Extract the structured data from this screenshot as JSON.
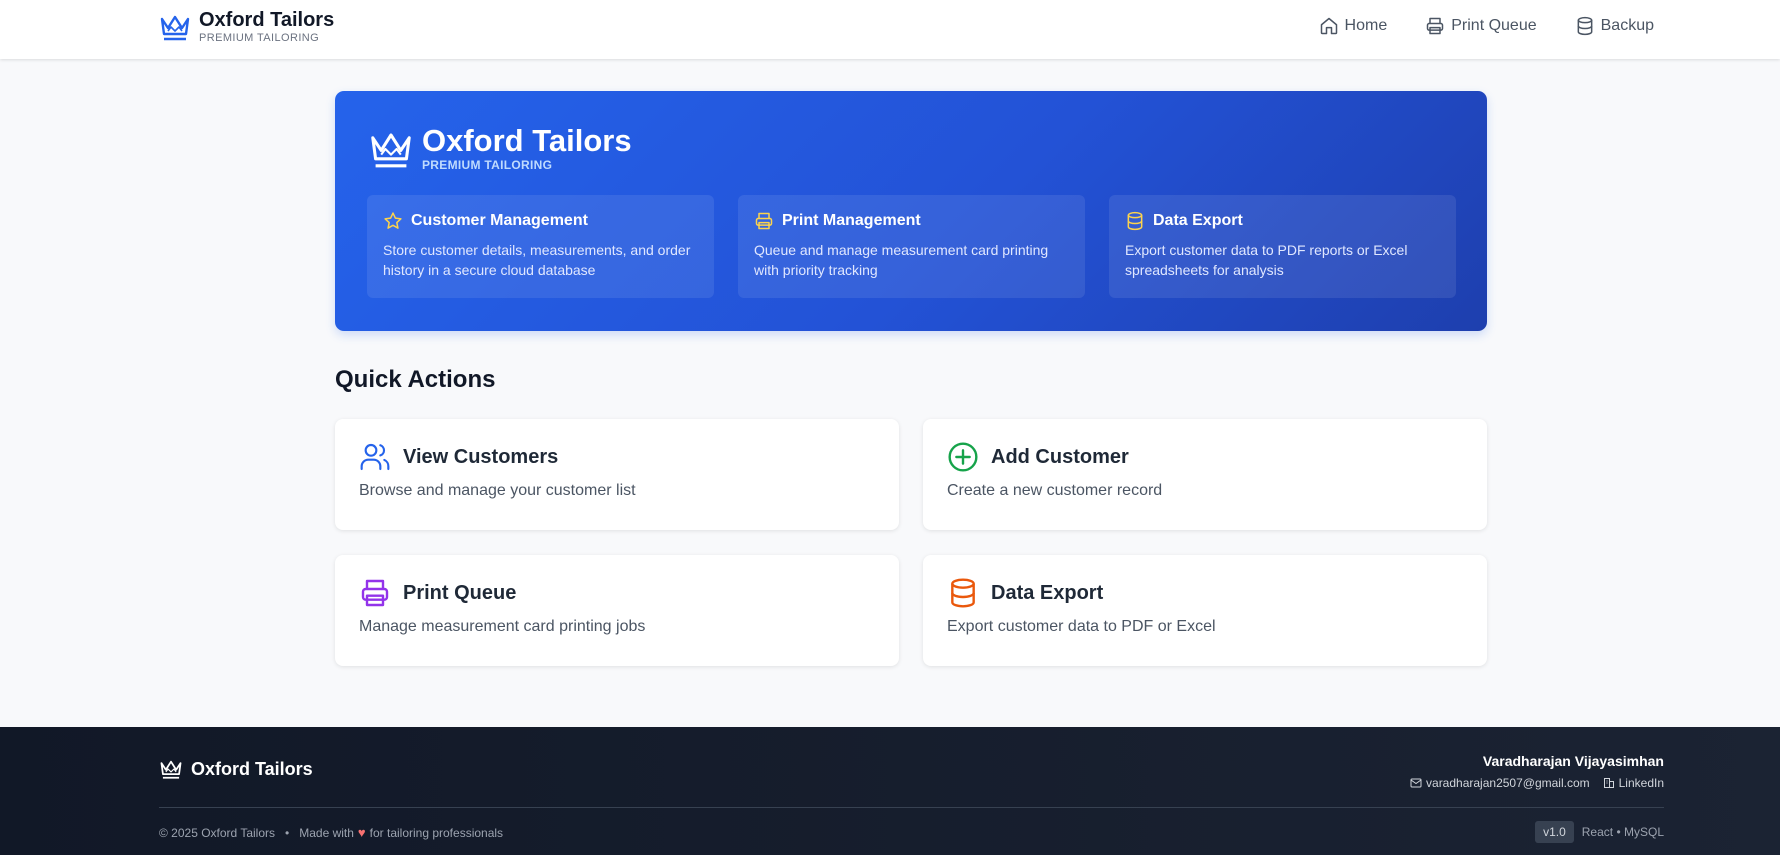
{
  "brand": {
    "name": "Oxford Tailors",
    "tagline": "PREMIUM TAILORING",
    "icon": "crown-icon",
    "accent": "#2563eb"
  },
  "nav": {
    "items": [
      {
        "label": "Home",
        "icon": "home-icon"
      },
      {
        "label": "Print Queue",
        "icon": "printer-icon"
      },
      {
        "label": "Backup",
        "icon": "database-icon"
      }
    ]
  },
  "hero": {
    "title": "Oxford Tailors",
    "subtitle": "PREMIUM TAILORING",
    "features": [
      {
        "title": "Customer Management",
        "description": "Store customer details, measurements, and order history in a secure cloud database",
        "icon": "star-icon"
      },
      {
        "title": "Print Management",
        "description": "Queue and manage measurement card printing with priority tracking",
        "icon": "printer-icon"
      },
      {
        "title": "Data Export",
        "description": "Export customer data to PDF reports or Excel spreadsheets for analysis",
        "icon": "database-icon"
      }
    ]
  },
  "quick_actions": {
    "heading": "Quick Actions",
    "cards": [
      {
        "title": "View Customers",
        "description": "Browse and manage your customer list",
        "icon": "users-icon",
        "color": "#2563eb"
      },
      {
        "title": "Add Customer",
        "description": "Create a new customer record",
        "icon": "plus-circle-icon",
        "color": "#16a34a"
      },
      {
        "title": "Print Queue",
        "description": "Manage measurement card printing jobs",
        "icon": "printer-icon",
        "color": "#9333ea"
      },
      {
        "title": "Data Export",
        "description": "Export customer data to PDF or Excel",
        "icon": "database-icon",
        "color": "#ea580c"
      }
    ]
  },
  "footer": {
    "brand": "Oxford Tailors",
    "author": "Varadharajan Vijayasimhan",
    "email": "varadharajan2507@gmail.com",
    "linkedin": "LinkedIn",
    "copyright": "© 2025 Oxford Tailors",
    "separator": "•",
    "made_with": "Made with",
    "made_for": "for tailoring professionals",
    "version": "v1.0",
    "stack": "React • MySQL"
  }
}
